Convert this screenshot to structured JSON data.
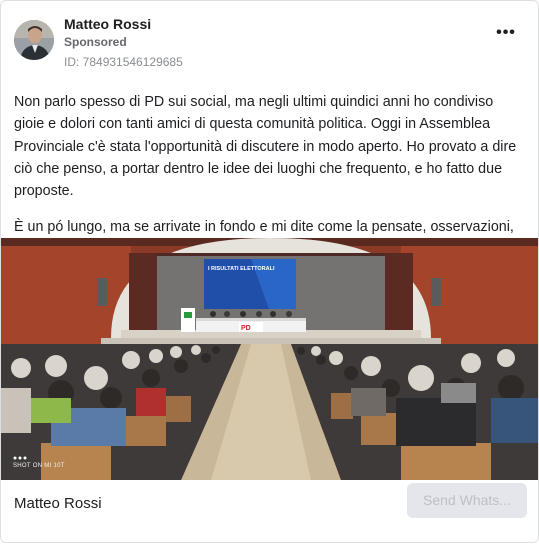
{
  "post": {
    "author": "Matteo Rossi",
    "sponsored_label": "Sponsored",
    "ad_id": "ID: 784931546129685",
    "more_icon": "more-options-icon",
    "text_paragraph_1": "Non parlo spesso di PD sui social, ma negli ultimi quindici anni ho condiviso gioie e dolori con tanti amici di questa comunità politica. Oggi in Assemblea Provinciale c'è stata l'opportunità di discutere in modo aperto. Ho provato a dire ciò che penso, a portar dentro le idee dei luoghi che frequento, e ho fatto due proposte.",
    "text_paragraph_2": "È un pó lungo, ma se arrivate in fondo e mi dite come la pensate, osservazioni, critiche, condivisioni, mi fa piacere...."
  },
  "media": {
    "screen_title": "I RISULTATI ELETTORALI",
    "podium_logo_text": "PD",
    "watermark": "SHOT ON MI 10T"
  },
  "footer": {
    "page_name": "Matteo Rossi",
    "cta_label": "Send Whats..."
  },
  "colors": {
    "text_primary": "#1c1e21",
    "text_secondary": "#65676b",
    "cta_background": "#e4e6eb",
    "cta_text": "#bcc0c4"
  }
}
